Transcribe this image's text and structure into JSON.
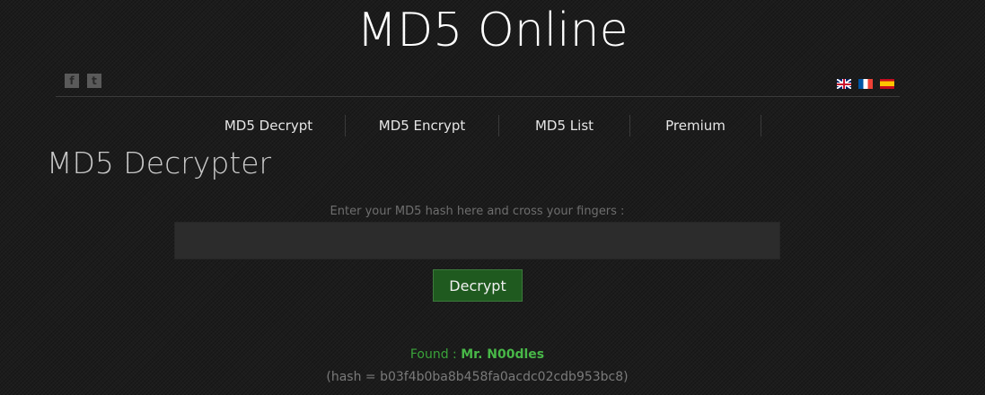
{
  "site": {
    "title": "MD5 Online"
  },
  "social": [
    {
      "icon": "facebook-icon",
      "glyph": "f"
    },
    {
      "icon": "twitter-icon",
      "glyph": "t"
    }
  ],
  "languages": [
    "english-flag-icon",
    "french-flag-icon",
    "spanish-flag-icon"
  ],
  "nav": {
    "items": [
      {
        "label": "MD5 Decrypt"
      },
      {
        "label": "MD5 Encrypt"
      },
      {
        "label": "MD5 List"
      },
      {
        "label": "Premium"
      }
    ]
  },
  "main": {
    "page_title": "MD5 Decrypter",
    "form": {
      "label": "Enter your MD5 hash here and cross your fingers :",
      "input_value": "",
      "button_label": "Decrypt"
    },
    "result": {
      "found_label": "Found : ",
      "found_value": "Mr. N00dles",
      "hash_text": "(hash = b03f4b0ba8b458fa0acdc02cdb953bc8)"
    }
  },
  "colors": {
    "background": "#1c1c1c",
    "button_green": "#1f5a1f",
    "found_green": "#3aa33a"
  }
}
